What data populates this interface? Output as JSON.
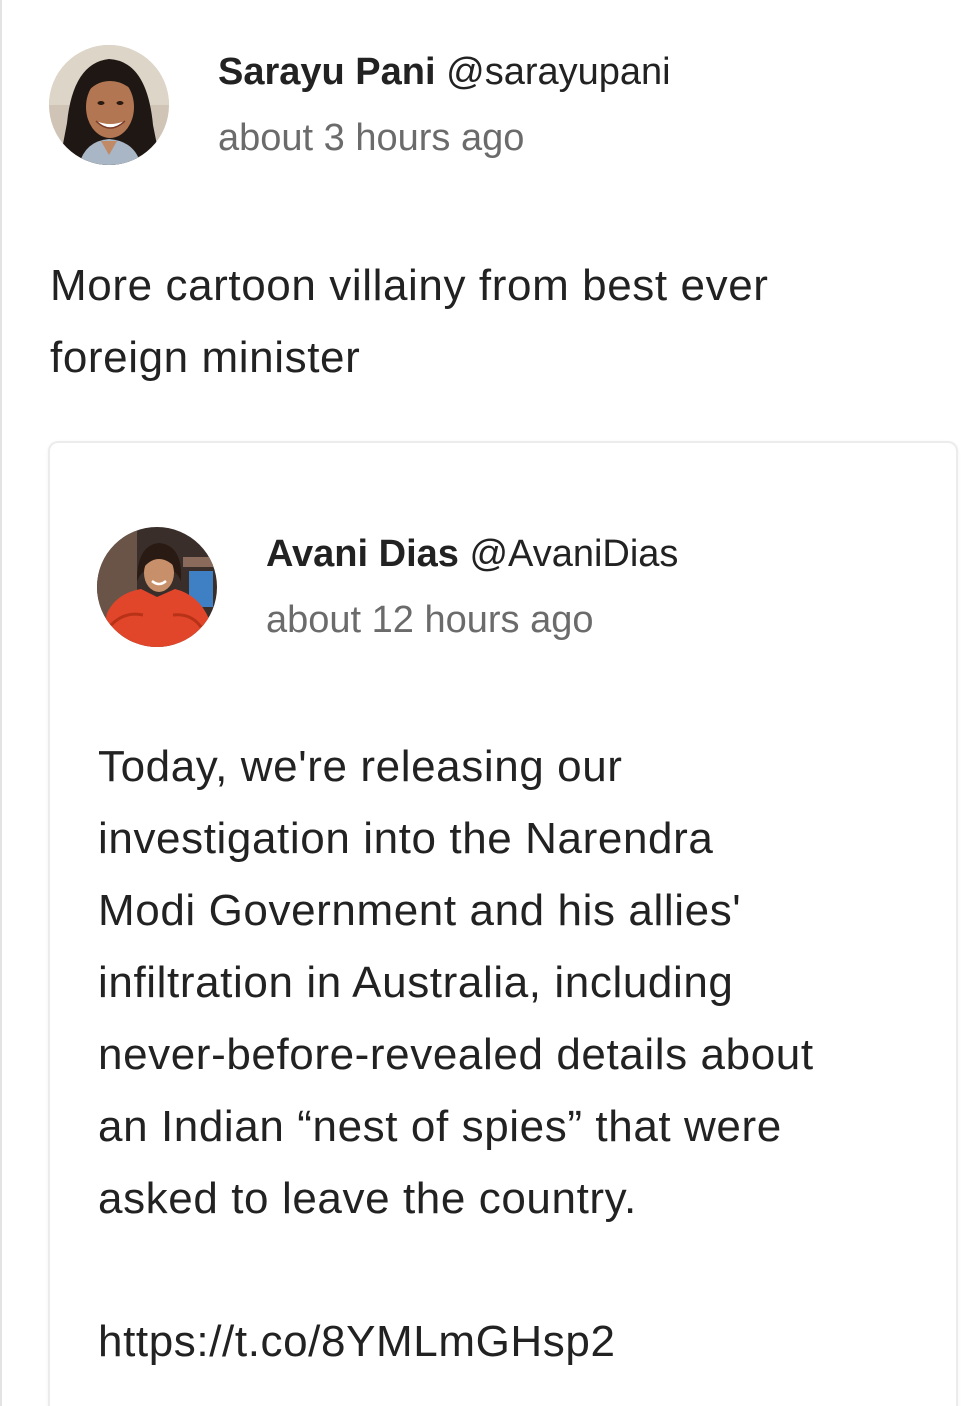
{
  "post": {
    "author": {
      "name": "Sarayu Pani",
      "handle": "@sarayupani",
      "avatar_icon": "profile-photo-avatar"
    },
    "timestamp": "about 3 hours ago",
    "text_lines": [
      "More cartoon villainy from best ever",
      "foreign minister"
    ]
  },
  "quoted_post": {
    "author": {
      "name": "Avani Dias",
      "handle": "@AvaniDias",
      "avatar_icon": "profile-photo-avatar"
    },
    "timestamp": "about 12 hours ago",
    "text_lines": [
      "Today, we're releasing our",
      "investigation into the Narendra",
      "Modi Government and his allies'",
      "infiltration in Australia, including",
      "never-before-revealed details about",
      "an Indian “nest of spies” that were",
      "asked to leave the country."
    ],
    "link": "https://t.co/8YMLmGHsp2"
  },
  "colors": {
    "text": "#222222",
    "muted": "#6b6b6b",
    "card_border": "#ececec"
  }
}
